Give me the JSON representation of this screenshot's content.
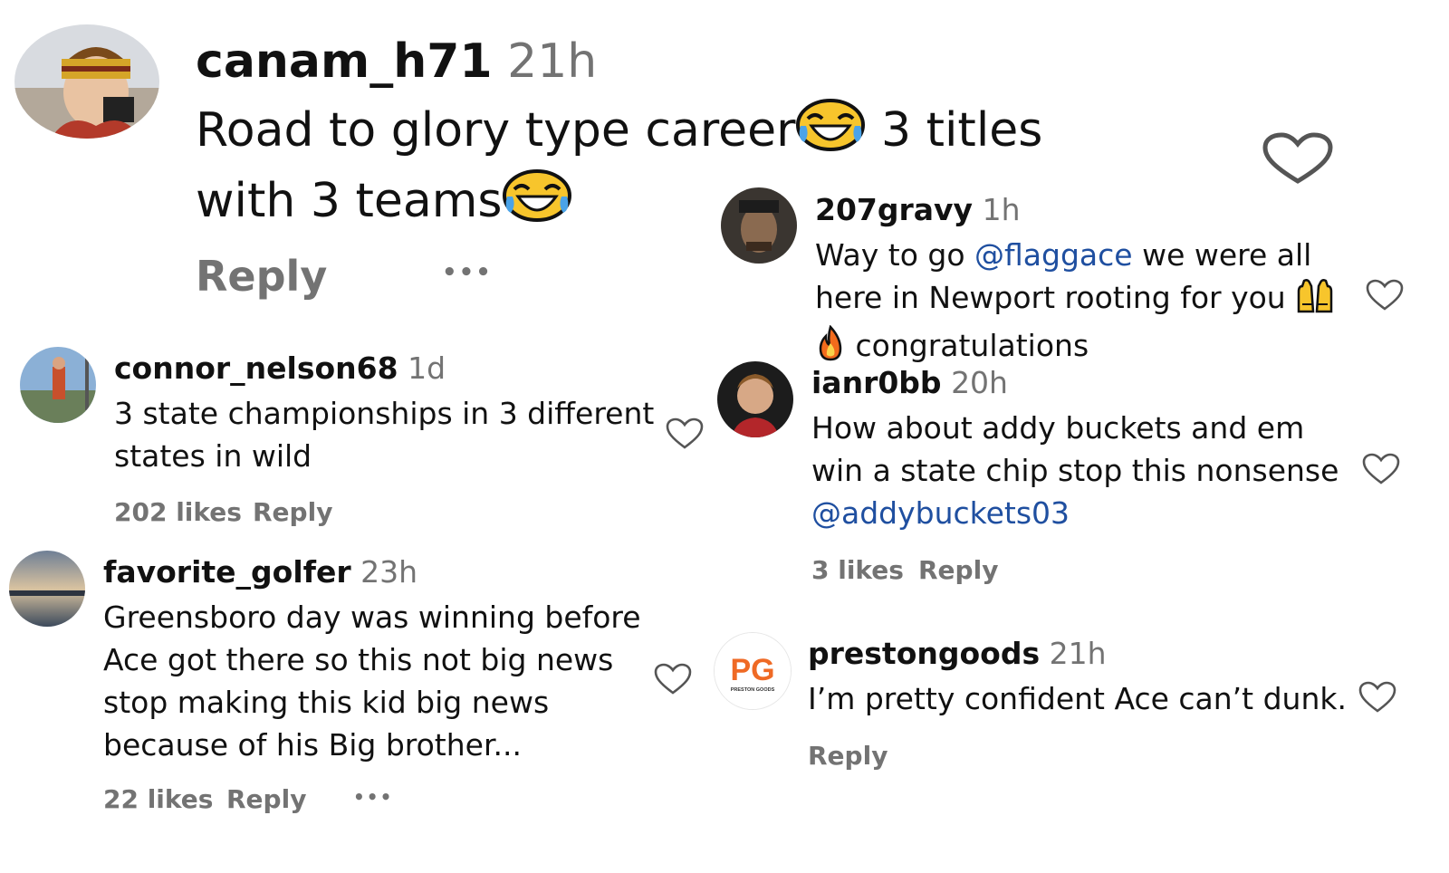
{
  "colors": {
    "text": "#111111",
    "muted": "#737373",
    "mention": "#1f4fa0",
    "background": "#ffffff"
  },
  "main_comment": {
    "username": "canam_h71",
    "time": "21h",
    "text_line1": "Road to glory type career",
    "text_line1b": "3 titles",
    "text_line2": "with 3 teams",
    "reply_label": "Reply",
    "more_label": "•••",
    "emoji": "joy-emoji"
  },
  "left_comments": [
    {
      "username": "connor_nelson68",
      "time": "1d",
      "text_lines": [
        "3 state championships in 3 different",
        "states in wild"
      ],
      "likes": "202 likes",
      "reply_label": "Reply"
    },
    {
      "username": "favorite_golfer",
      "time": "23h",
      "text_lines": [
        "Greensboro day was winning before",
        "Ace got there so this not big news",
        "stop making this kid big news",
        "because of his Big brother..."
      ],
      "likes": "22 likes",
      "reply_label": "Reply",
      "more_label": "•••"
    }
  ],
  "right_comments": [
    {
      "username": "207gravy",
      "time": "1h",
      "line1_a": "Way to go ",
      "line1_mention": "@flaggace",
      "line1_b": " we were all",
      "line2": "here in Newport rooting for you",
      "line3": "congratulations",
      "emoji_raise": "raising-hands-emoji",
      "emoji_fire": "fire-emoji"
    },
    {
      "username": "ianr0bb",
      "time": "20h",
      "text_lines": [
        "How about addy buckets and em",
        "win a state chip stop this nonsense"
      ],
      "mention": "@addybuckets03",
      "likes": "3 likes",
      "reply_label": "Reply"
    },
    {
      "username": "prestongoods",
      "time": "21h",
      "text_lines": [
        "I’m pretty confident Ace can’t dunk."
      ],
      "reply_label": "Reply",
      "avatar_logo_text": "PG",
      "avatar_logo_subtext": "PRESTON GOODS"
    }
  ]
}
